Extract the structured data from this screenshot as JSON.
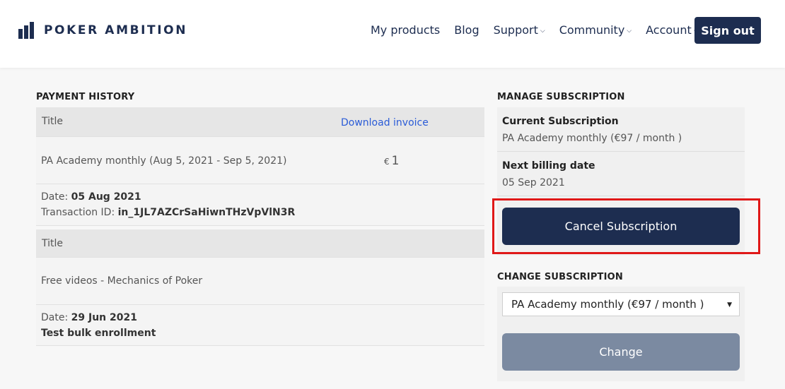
{
  "header": {
    "brand": "POKER AMBITION",
    "nav": [
      {
        "label": "My products",
        "dropdown": false
      },
      {
        "label": "Blog",
        "dropdown": false
      },
      {
        "label": "Support",
        "dropdown": true
      },
      {
        "label": "Community",
        "dropdown": true
      },
      {
        "label": "Account",
        "dropdown": true
      }
    ],
    "signout_label": "Sign out"
  },
  "payment_history": {
    "title": "PAYMENT HISTORY",
    "entries": [
      {
        "title_header": "Title",
        "download_label": "Download invoice",
        "item": "PA Academy monthly (Aug 5, 2021 - Sep 5, 2021)",
        "currency": "€",
        "amount": "1",
        "date_label": "Date:",
        "date": "05 Aug 2021",
        "txn_label": "Transaction ID:",
        "txn_id": "in_1JL7AZCrSaHiwnTHzVpVlN3R"
      },
      {
        "title_header": "Title",
        "item": "Free videos - Mechanics of Poker",
        "date_label": "Date:",
        "date": "29 Jun 2021",
        "note": "Test bulk enrollment"
      }
    ]
  },
  "manage": {
    "title": "MANAGE SUBSCRIPTION",
    "current_label": "Current Subscription",
    "current_value": "PA Academy monthly (€97 / month )",
    "next_label": "Next billing date",
    "next_value": "05 Sep 2021",
    "cancel_label": "Cancel Subscription"
  },
  "change": {
    "title": "CHANGE SUBSCRIPTION",
    "selected": "PA Academy monthly (€97 / month )",
    "button_label": "Change"
  },
  "colors": {
    "brand": "#1d2d50",
    "link": "#2a5bd7",
    "highlight": "#e01818",
    "disabled_button": "#7b8aa1"
  }
}
